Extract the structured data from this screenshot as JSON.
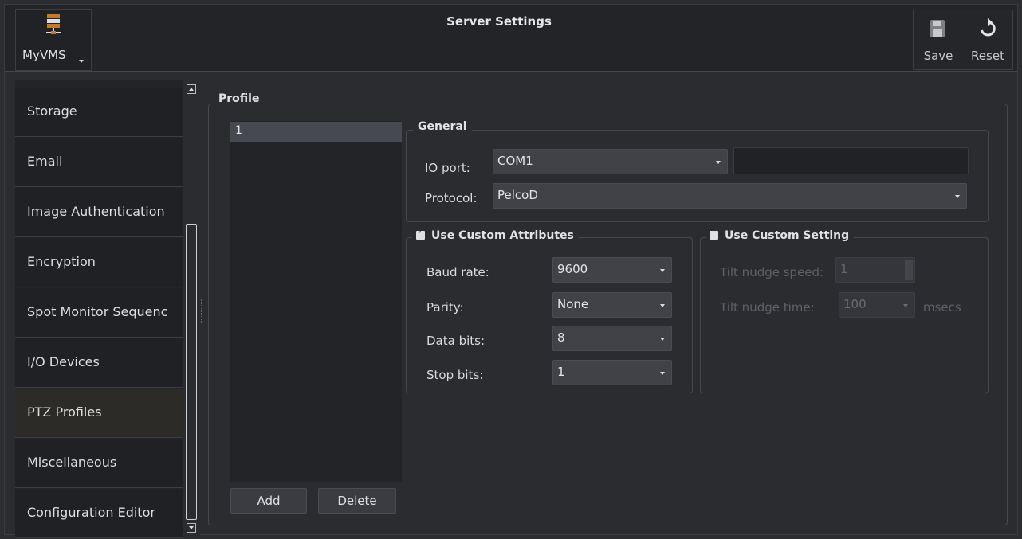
{
  "app": {
    "name": "MyVMS",
    "window_title": "Server Settings"
  },
  "toolbar": {
    "save_label": "Save",
    "reset_label": "Reset"
  },
  "sidebar": {
    "items": [
      {
        "label": "Storage"
      },
      {
        "label": "Email"
      },
      {
        "label": "Image Authentication"
      },
      {
        "label": "Encryption"
      },
      {
        "label": "Spot Monitor Sequenc"
      },
      {
        "label": "I/O Devices"
      },
      {
        "label": "PTZ Profiles",
        "selected": true
      },
      {
        "label": "Miscellaneous"
      },
      {
        "label": "Configuration Editor"
      }
    ]
  },
  "profile": {
    "group_title": "Profile",
    "items": [
      "1"
    ],
    "add_label": "Add",
    "delete_label": "Delete"
  },
  "general": {
    "group_title": "General",
    "io_port_label": "IO port:",
    "io_port_value": "COM1",
    "io_port_text": "",
    "protocol_label": "Protocol:",
    "protocol_value": "PelcoD"
  },
  "custom_attributes": {
    "checkbox_label": "Use Custom Attributes",
    "checked": true,
    "baud_rate_label": "Baud rate:",
    "baud_rate_value": "9600",
    "parity_label": "Parity:",
    "parity_value": "None",
    "data_bits_label": "Data bits:",
    "data_bits_value": "8",
    "stop_bits_label": "Stop bits:",
    "stop_bits_value": "1"
  },
  "custom_setting": {
    "checkbox_label": "Use Custom Setting",
    "checked": false,
    "tilt_speed_label": "Tilt nudge speed:",
    "tilt_speed_value": "1",
    "tilt_time_label": "Tilt nudge time:",
    "tilt_time_value": "100",
    "tilt_time_unit": "msecs"
  },
  "colors": {
    "background": "#2a2c30",
    "selected_item": "#2c2b27",
    "list_selection": "#474950"
  }
}
